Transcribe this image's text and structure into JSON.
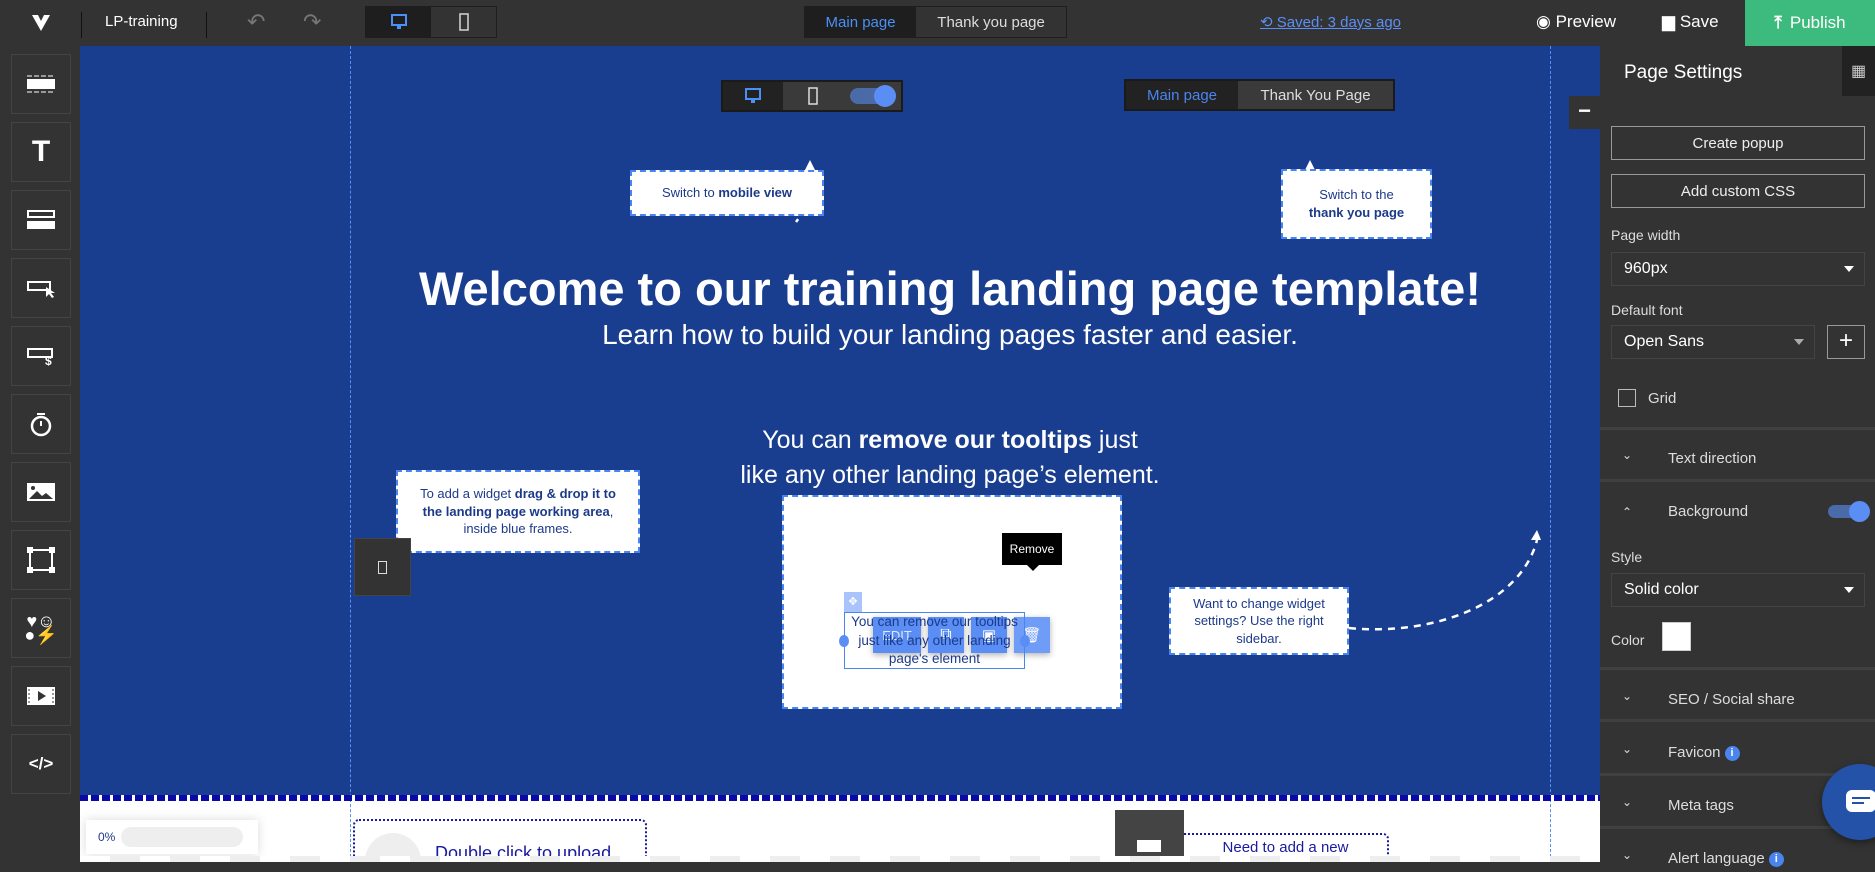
{
  "topbar": {
    "project_name": "LP-training",
    "tabs": [
      {
        "label": "Main page",
        "active": true
      },
      {
        "label": "Thank you page",
        "active": false
      }
    ],
    "saved_label": "Saved: 3 days ago",
    "preview_label": "Preview",
    "save_label": "Save",
    "publish_label": "Publish",
    "publish_color": "#3dba7d",
    "device": "desktop"
  },
  "sidebar": {
    "items": [
      "section",
      "text",
      "form",
      "button",
      "payment-button",
      "timer",
      "image",
      "box",
      "icons",
      "video",
      "custom-code"
    ]
  },
  "canvas": {
    "background_color": "#193e8f",
    "demo_tabs": [
      "Main page",
      "Thank You Page"
    ],
    "tip_mobile": {
      "pre": "Switch to ",
      "bold": "mobile view"
    },
    "tip_thanks": {
      "pre": "Switch to the",
      "bold": "thank you page"
    },
    "heading": "Welcome to our training landing page template!",
    "subheading": "Learn how to build your landing pages faster and easier.",
    "remove_line": {
      "pre": "You can ",
      "bold": "remove our tooltips",
      "post": " just",
      "line2": "like any other landing page’s element."
    },
    "tip_widget": {
      "pre": "To add a widget ",
      "bold1": "drag & drop it to the landing page working area",
      "post": ", inside blue frames."
    },
    "toolbar": {
      "edit_label": "EDIT",
      "remove_tooltip": "Remove"
    },
    "selected_text": "You can remove our tooltips just like any other landing page's element",
    "tip_settings": "Want to change widget settings? Use the right sidebar.",
    "progress": {
      "label": "0%",
      "value": 0
    },
    "upload_text": "Double click to upload",
    "add_new_text": "Need to add a new"
  },
  "panel": {
    "title": "Page Settings",
    "create_popup": "Create popup",
    "add_css": "Add custom CSS",
    "page_width_label": "Page width",
    "page_width_value": "960px",
    "default_font_label": "Default font",
    "default_font_value": "Open Sans",
    "grid_label": "Grid",
    "grid_checked": false,
    "text_direction": "Text direction",
    "background": "Background",
    "background_enabled": true,
    "style_label": "Style",
    "style_value": "Solid color",
    "color_label": "Color",
    "color_value": "#ffffff",
    "seo": "SEO / Social share",
    "favicon": "Favicon",
    "meta_tags": "Meta tags",
    "alert_language": "Alert language"
  }
}
